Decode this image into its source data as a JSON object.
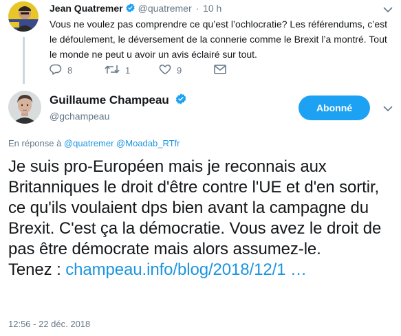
{
  "parent_tweet": {
    "name": "Jean Quatremer",
    "handle": "@quatremer",
    "separator": "·",
    "time": "10 h",
    "text": "Vous ne voulez pas comprendre ce qu’est l’ochloc​ratie? Les référendums, c’est le défoulement, le déversement de la connerie comme le Brexit l’a montré. Tout le monde ne peut u avoir un avis éclairé sur tout.",
    "reply_count": "8",
    "retweet_count": "1",
    "like_count": "9"
  },
  "main_tweet": {
    "name": "Guillaume Champeau",
    "handle": "@gchampeau",
    "follow_label": "Abonné",
    "reply_prefix": "En réponse à",
    "reply_mention_1": "@quatremer",
    "reply_mention_2": "@Moadab_RTfr",
    "text_body": "Je suis pro-Européen mais je reconnais aux Britanniques le droit d'être contre l'UE et d'en sortir, ce qu'ils voulaient dps bien avant la campagne du Brexit. C'est ça la démocratie. Vous avez le droit de pas être démocrate mais alors assumez-le.",
    "text_tenez": "Tenez :",
    "link": "champeau.info/blog/2018/12/1 …",
    "timestamp": "12:56 - 22 déc. 2018"
  },
  "colors": {
    "accent": "#1da1f2",
    "link": "#1b95e0",
    "secondary_text": "#657786",
    "thread_line": "#ccd6dd"
  }
}
